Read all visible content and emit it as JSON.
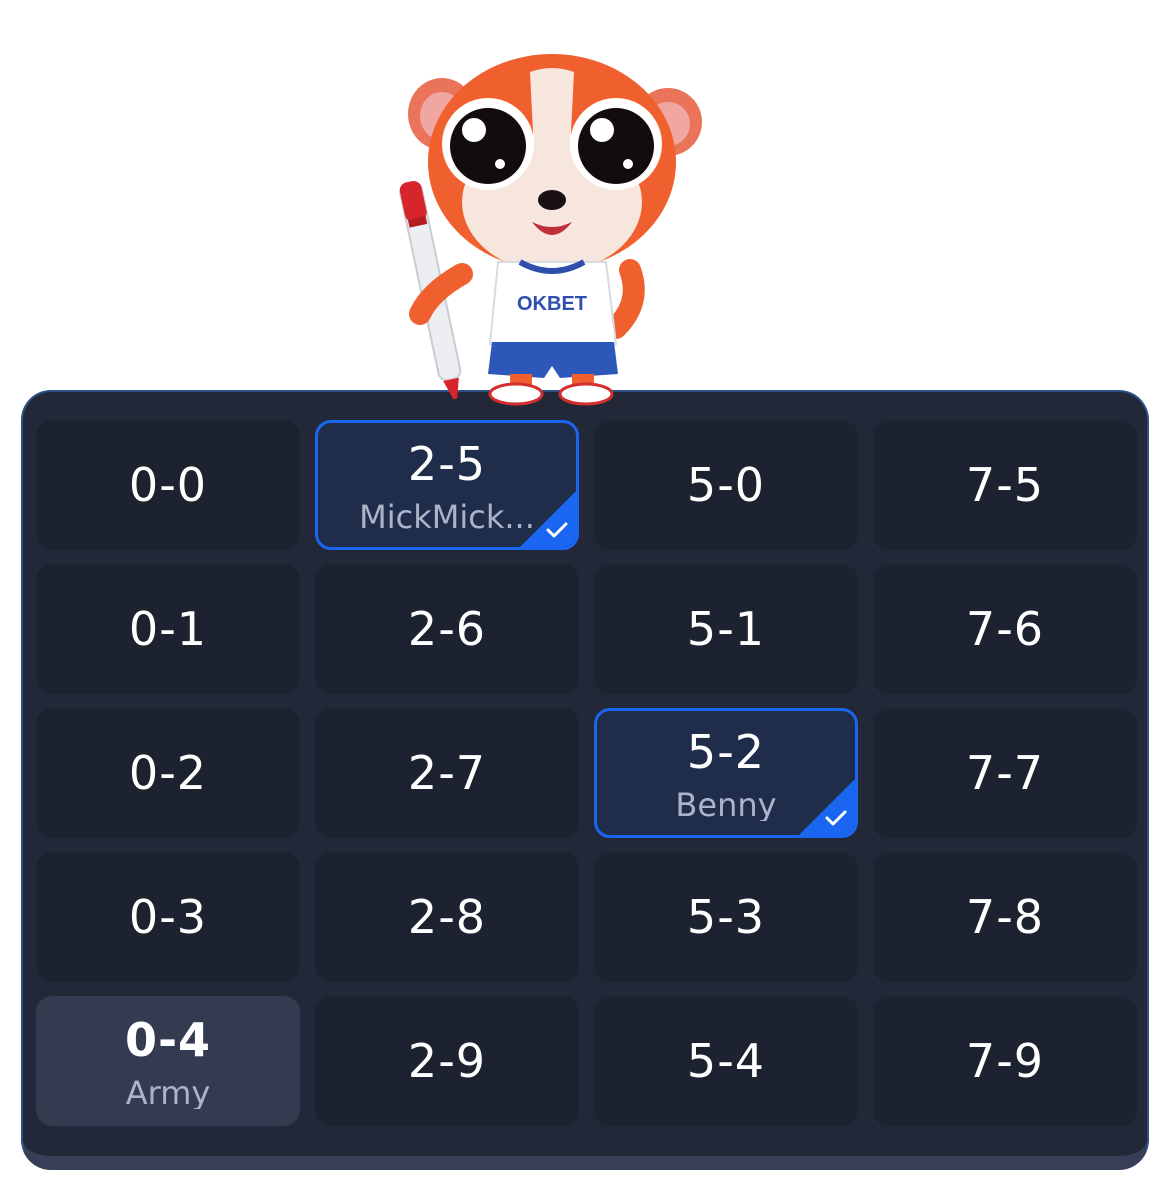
{
  "mascot": {
    "shirt_text": "OKBET",
    "icon": "red-panda-mascot-holding-marker"
  },
  "colors": {
    "board_bg": "#222838",
    "cell_bg": "#1d2231",
    "selected_bg": "#1f2d4a",
    "accent_blue": "#1a66f0",
    "own_cell_bg": "#343b50"
  },
  "cells": [
    {
      "score": "0-0",
      "name": ""
    },
    {
      "score": "2-5",
      "name": "MickMick...",
      "state": "selected"
    },
    {
      "score": "5-0",
      "name": ""
    },
    {
      "score": "7-5",
      "name": ""
    },
    {
      "score": "0-1",
      "name": ""
    },
    {
      "score": "2-6",
      "name": ""
    },
    {
      "score": "5-1",
      "name": ""
    },
    {
      "score": "7-6",
      "name": ""
    },
    {
      "score": "0-2",
      "name": ""
    },
    {
      "score": "2-7",
      "name": ""
    },
    {
      "score": "5-2",
      "name": "Benny",
      "state": "selected"
    },
    {
      "score": "7-7",
      "name": ""
    },
    {
      "score": "0-3",
      "name": ""
    },
    {
      "score": "2-8",
      "name": ""
    },
    {
      "score": "5-3",
      "name": ""
    },
    {
      "score": "7-8",
      "name": ""
    },
    {
      "score": "0-4",
      "name": "Army",
      "state": "own"
    },
    {
      "score": "2-9",
      "name": ""
    },
    {
      "score": "5-4",
      "name": ""
    },
    {
      "score": "7-9",
      "name": ""
    }
  ]
}
